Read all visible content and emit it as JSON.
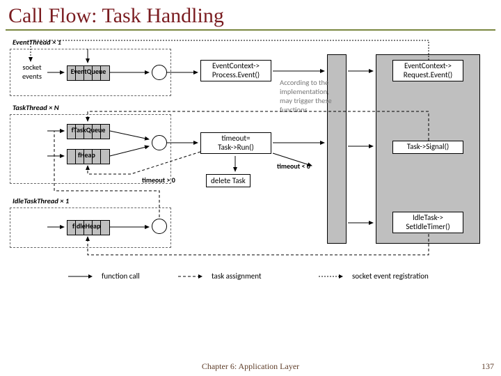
{
  "title": "Call Flow: Task Handling",
  "threads": {
    "event": "EventThread × 1",
    "task": "TaskThread × N",
    "idle": "IdleTaskThread × 1"
  },
  "boxes": {
    "socket_events": "socket\nevents",
    "event_queue": "EventQueue",
    "ftask_queue": "fTaskQueue",
    "fheap": "fHeap",
    "fidle_heap": "fIdleHeap",
    "process_event": "EventContext->\nProcess.Event()",
    "request_event": "EventContext->\nRequest.Event()",
    "timeout_run": "timeout=\nTask->Run()",
    "task_signal": "Task->Signal()",
    "delete_task": "delete Task",
    "idle_timer": "IdleTask->\nSetIdleTimer()"
  },
  "note": "According to the\nimplementation,\nmay trigger these\nfunctions",
  "edge_labels": {
    "timeout_lt0": "timeout < 0",
    "timeout_gt0": "timeout > 0"
  },
  "legend": {
    "func_call": "function call",
    "task_assign": "task assignment",
    "socket_reg": "socket event registration"
  },
  "footer": "Chapter 6: Application Layer",
  "page": "137"
}
